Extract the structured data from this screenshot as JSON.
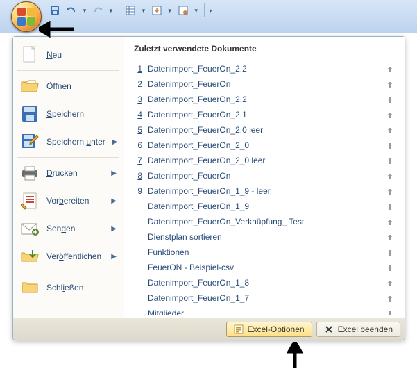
{
  "qat": {
    "buttons": [
      "save-icon",
      "undo-icon",
      "redo-icon",
      "custom1-icon",
      "custom2-icon",
      "custom3-icon"
    ]
  },
  "left_menu": {
    "items": [
      {
        "label": "Neu",
        "underline_index": 0,
        "icon": "new",
        "submenu": false
      },
      {
        "label": "Öffnen",
        "underline_index": 0,
        "icon": "open",
        "submenu": false
      },
      {
        "label": "Speichern",
        "underline_index": 0,
        "icon": "save",
        "submenu": false
      },
      {
        "label": "Speichern unter",
        "underline_index": 10,
        "icon": "saveas",
        "submenu": true
      },
      {
        "label": "Drucken",
        "underline_index": 0,
        "icon": "print",
        "submenu": true
      },
      {
        "label": "Vorbereiten",
        "underline_index": 3,
        "icon": "prepare",
        "submenu": true
      },
      {
        "label": "Senden",
        "underline_index": 3,
        "icon": "send",
        "submenu": true
      },
      {
        "label": "Veröffentlichen",
        "underline_index": 3,
        "icon": "publish",
        "submenu": true
      },
      {
        "label": "Schließen",
        "underline_index": 4,
        "icon": "close",
        "submenu": false
      }
    ]
  },
  "recent": {
    "header": "Zuletzt verwendete Dokumente",
    "items": [
      {
        "num": "1",
        "name": "Datenimport_FeuerOn_2.2"
      },
      {
        "num": "2",
        "name": "Datenimport_FeuerOn"
      },
      {
        "num": "3",
        "name": "Datenimport_FeuerOn_2.2"
      },
      {
        "num": "4",
        "name": "Datenimport_FeuerOn_2.1"
      },
      {
        "num": "5",
        "name": "Datenimport_FeuerOn_2.0 leer"
      },
      {
        "num": "6",
        "name": "Datenimport_FeuerOn_2_0"
      },
      {
        "num": "7",
        "name": "Datenimport_FeuerOn_2_0 leer"
      },
      {
        "num": "8",
        "name": "Datenimport_FeuerOn"
      },
      {
        "num": "9",
        "name": "Datenimport_FeuerOn_1_9 - leer"
      },
      {
        "num": "",
        "name": "Datenimport_FeuerOn_1_9"
      },
      {
        "num": "",
        "name": "Datenimport_FeuerOn_Verknüpfung_ Test"
      },
      {
        "num": "",
        "name": "Dienstplan sortieren"
      },
      {
        "num": "",
        "name": "Funktionen"
      },
      {
        "num": "",
        "name": "FeuerON - Beispiel-csv"
      },
      {
        "num": "",
        "name": "Datenimport_FeuerOn_1_8"
      },
      {
        "num": "",
        "name": "Datenimport_FeuerOn_1_7"
      },
      {
        "num": "",
        "name": "Mitglieder"
      }
    ]
  },
  "footer": {
    "options_label": "Excel-Optionen",
    "exit_label": "Excel beenden"
  }
}
